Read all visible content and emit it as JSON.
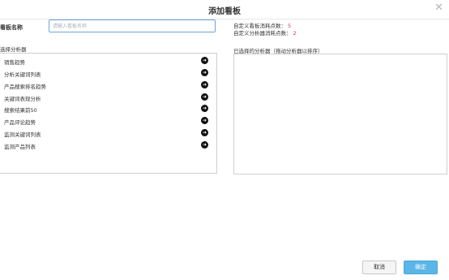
{
  "dialog": {
    "title": "添加看板",
    "close_icon": "✕"
  },
  "name_field": {
    "label": "看板名称",
    "placeholder": "请输入看板名称",
    "value": ""
  },
  "stats": {
    "line1_label": "自定义看板消耗点数：",
    "line1_value": "5",
    "line2_label": "自定义分析器消耗点数：",
    "line2_value": "2",
    "highlight_color": "#d9363e"
  },
  "analyzers": {
    "section_label": "选择分析器",
    "items": [
      {
        "label": "销售趋势",
        "icon": "arrow-right-icon"
      },
      {
        "label": "分析关键词列表",
        "icon": "arrow-right-icon"
      },
      {
        "label": "产品搜索排名趋势",
        "icon": "arrow-right-icon"
      },
      {
        "label": "关键词表现分析",
        "icon": "arrow-right-icon"
      },
      {
        "label": "搜索结果前50",
        "icon": "arrow-right-icon"
      },
      {
        "label": "产品评论趋势",
        "icon": "arrow-right-icon"
      },
      {
        "label": "监测关键词列表",
        "icon": "arrow-right-icon"
      },
      {
        "label": "监测产品列表",
        "icon": "arrow-right-icon"
      }
    ]
  },
  "selected": {
    "section_label": "已选择的分析器（拖动分析器以排序）",
    "items": []
  },
  "buttons": {
    "cancel": "取消",
    "confirm": "确定",
    "confirm_color": "#5bb5e6"
  }
}
